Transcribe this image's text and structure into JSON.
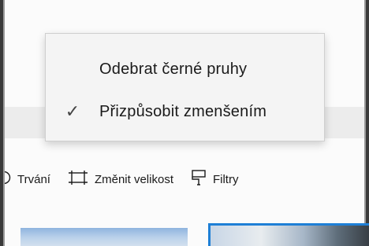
{
  "menu": {
    "items": [
      {
        "label": "Odebrat černé pruhy",
        "checked": false
      },
      {
        "label": "Přizpůsobit zmenšením",
        "checked": true
      }
    ],
    "check_glyph": "✓"
  },
  "toolbar": {
    "items": [
      {
        "label": "Trvání",
        "icon": "clock-icon"
      },
      {
        "label": "Změnit velikost",
        "icon": "resize-icon"
      },
      {
        "label": "Filtry",
        "icon": "filter-brush-icon"
      }
    ]
  },
  "colors": {
    "accent": "#1e7fd6",
    "menu_background": "#f4f4f4",
    "border": "#3a3a3a"
  }
}
